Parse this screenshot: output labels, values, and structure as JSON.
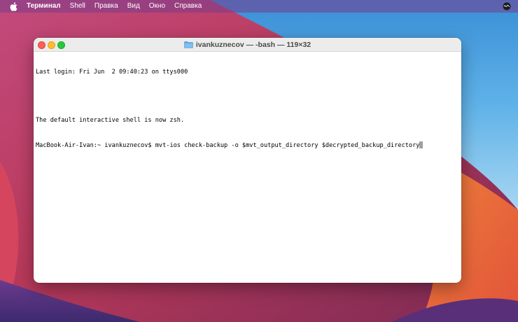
{
  "menubar": {
    "app_name": "Терминал",
    "items": [
      "Shell",
      "Правка",
      "Вид",
      "Окно",
      "Справка"
    ]
  },
  "window": {
    "title": "ivankuznecov — -bash — 119×32",
    "lines": [
      "Last login: Fri Jun  2 09:40:23 on ttys000",
      "",
      "The default interactive shell is now zsh."
    ],
    "prompt": "MacBook-Air-Ivan:~ ivankuznecov$ ",
    "command": "mvt-ios check-backup -o $mvt_output_directory $decrypted_backup_directory"
  },
  "icons": {
    "apple": "apple-logo-icon",
    "folder": "folder-icon",
    "siri": "siri-icon"
  },
  "colors": {
    "close": "#ff5f57",
    "minimize": "#febc2e",
    "maximize": "#28c840"
  }
}
